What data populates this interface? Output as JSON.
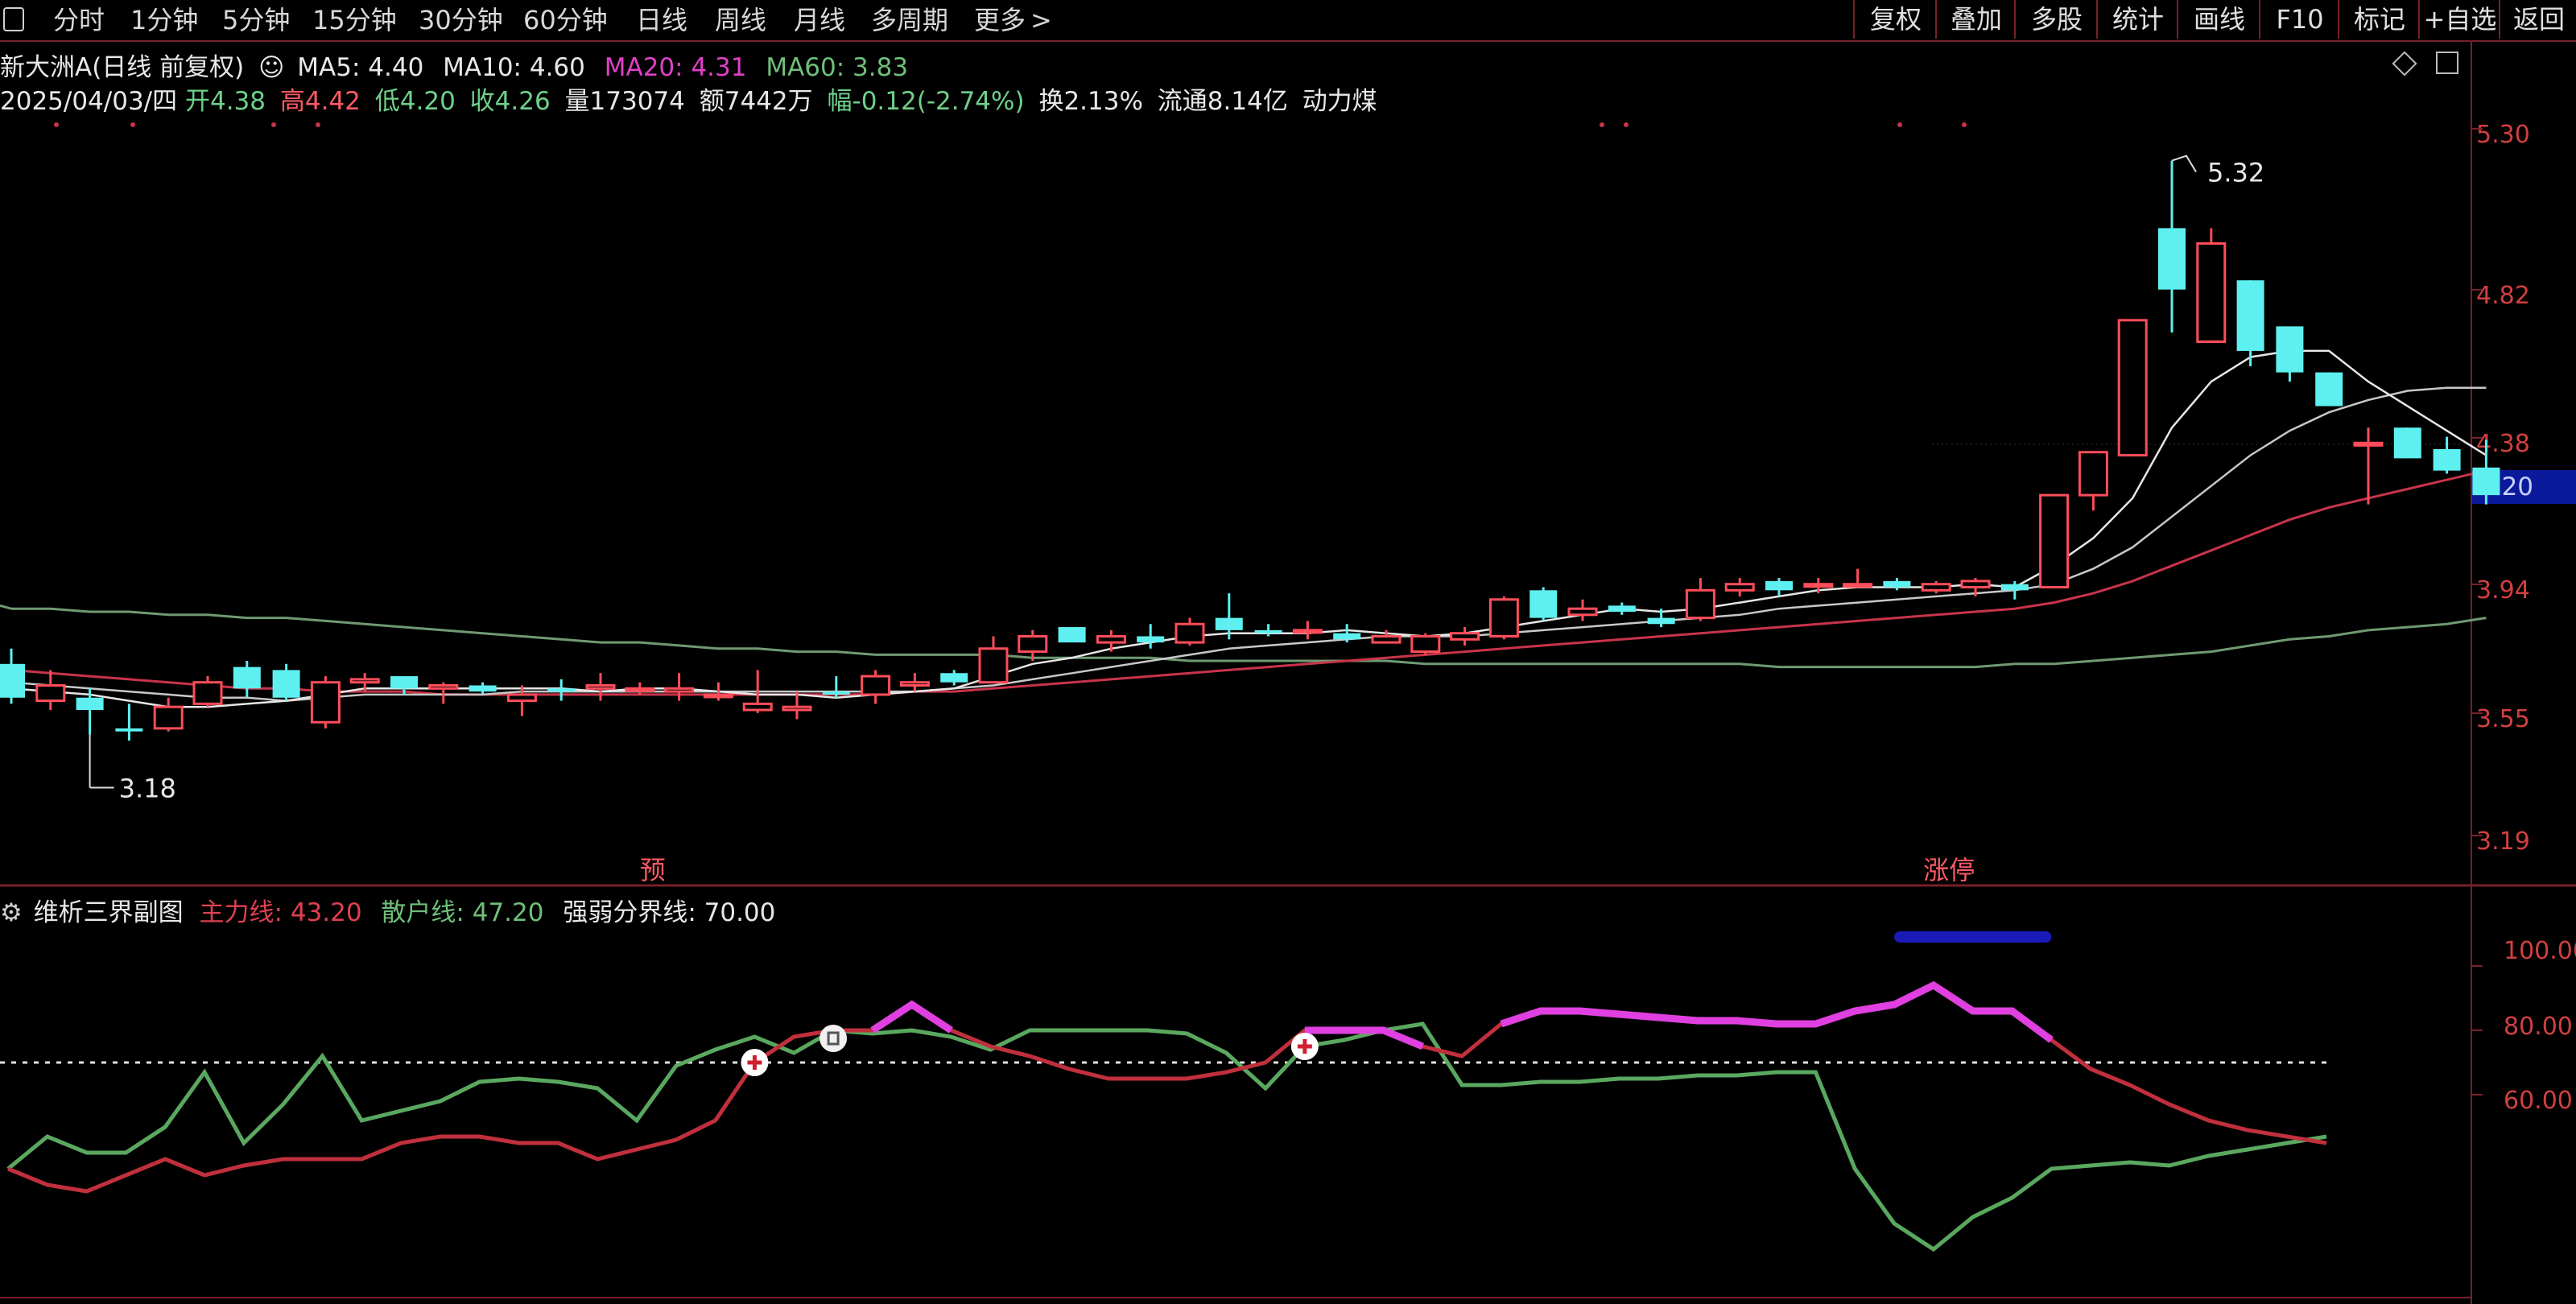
{
  "toolbar": {
    "periods": [
      "分时",
      "1分钟",
      "5分钟",
      "15分钟",
      "30分钟",
      "60分钟",
      "日线",
      "周线",
      "月线",
      "多周期",
      "更多"
    ],
    "more_arrow": ">",
    "right_buttons": [
      "复权",
      "叠加",
      "多股",
      "统计",
      "画线",
      "F10",
      "标记",
      "+自选",
      "返回"
    ]
  },
  "stock": {
    "name": "新大洲A(日线 前复权)",
    "ma5_label": "MA5: 4.40",
    "ma10_label": "MA10: 4.60",
    "ma20_label": "MA20: 4.31",
    "ma60_label": "MA60: 3.83",
    "date": "2025/04/03/四",
    "open": "开4.38",
    "high": "高4.42",
    "low": "低4.20",
    "close": "收4.26",
    "volume": "量173074",
    "amount": "额7442万",
    "change": "幅-0.12(-2.74%)",
    "turnover": "换2.13%",
    "float": "流通8.14亿",
    "concept": "动力煤"
  },
  "price_axis": [
    "5.30",
    "4.82",
    "4.38",
    "3.94",
    "3.55",
    "3.19"
  ],
  "current_price": "4.20",
  "annotations": {
    "high": "5.32",
    "low": "3.18",
    "event1": "预",
    "event2": "涨停"
  },
  "indicator": {
    "name": "维析三界副图",
    "main_label": "主力线: 43.20",
    "retail_label": "散户线: 47.20",
    "threshold_label": "强弱分界线: 70.00",
    "axis": [
      "100.00",
      "80.00",
      "60.00"
    ]
  },
  "colors": {
    "up": "#ff4d5a",
    "down": "#5ef0f0",
    "ma5": "#e6e6e6",
    "ma10": "#c8c8c8",
    "ma20": "#c8344a",
    "ma60": "#6f9a72",
    "main_line": "#c0303c",
    "retail_line": "#5aa860",
    "strong": "#e040e0",
    "marker": "#1a1ab8"
  },
  "chart_data": {
    "type": "candlestick",
    "ylim": [
      3.05,
      5.45
    ],
    "candles": [
      [
        3.68,
        3.73,
        3.55,
        3.57
      ],
      [
        3.56,
        3.66,
        3.53,
        3.61
      ],
      [
        3.57,
        3.6,
        3.45,
        3.53
      ],
      [
        3.47,
        3.55,
        3.43,
        3.46
      ],
      [
        3.47,
        3.57,
        3.46,
        3.54
      ],
      [
        3.55,
        3.64,
        3.54,
        3.62
      ],
      [
        3.67,
        3.69,
        3.57,
        3.6
      ],
      [
        3.66,
        3.68,
        3.56,
        3.57
      ],
      [
        3.49,
        3.64,
        3.47,
        3.62
      ],
      [
        3.62,
        3.65,
        3.59,
        3.63
      ],
      [
        3.64,
        3.64,
        3.58,
        3.6
      ],
      [
        3.6,
        3.62,
        3.55,
        3.61
      ],
      [
        3.61,
        3.62,
        3.58,
        3.59
      ],
      [
        3.56,
        3.61,
        3.51,
        3.58
      ],
      [
        3.6,
        3.63,
        3.56,
        3.59
      ],
      [
        3.6,
        3.65,
        3.56,
        3.61
      ],
      [
        3.6,
        3.62,
        3.58,
        3.6
      ],
      [
        3.59,
        3.65,
        3.56,
        3.6
      ],
      [
        3.58,
        3.62,
        3.56,
        3.58
      ],
      [
        3.53,
        3.66,
        3.52,
        3.55
      ],
      [
        3.53,
        3.59,
        3.5,
        3.54
      ],
      [
        3.59,
        3.64,
        3.57,
        3.58
      ],
      [
        3.58,
        3.66,
        3.55,
        3.64
      ],
      [
        3.61,
        3.65,
        3.59,
        3.62
      ],
      [
        3.65,
        3.66,
        3.61,
        3.62
      ],
      [
        3.62,
        3.77,
        3.62,
        3.73
      ],
      [
        3.72,
        3.79,
        3.69,
        3.77
      ],
      [
        3.8,
        3.8,
        3.75,
        3.75
      ],
      [
        3.75,
        3.79,
        3.72,
        3.77
      ],
      [
        3.77,
        3.81,
        3.73,
        3.75
      ],
      [
        3.75,
        3.83,
        3.74,
        3.81
      ],
      [
        3.83,
        3.91,
        3.76,
        3.79
      ],
      [
        3.79,
        3.81,
        3.77,
        3.78
      ],
      [
        3.79,
        3.82,
        3.76,
        3.79
      ],
      [
        3.78,
        3.81,
        3.75,
        3.76
      ],
      [
        3.75,
        3.79,
        3.75,
        3.77
      ],
      [
        3.72,
        3.78,
        3.71,
        3.77
      ],
      [
        3.76,
        3.8,
        3.74,
        3.78
      ],
      [
        3.77,
        3.9,
        3.76,
        3.89
      ],
      [
        3.92,
        3.93,
        3.82,
        3.83
      ],
      [
        3.84,
        3.89,
        3.82,
        3.86
      ],
      [
        3.87,
        3.88,
        3.84,
        3.85
      ],
      [
        3.83,
        3.86,
        3.8,
        3.81
      ],
      [
        3.83,
        3.96,
        3.82,
        3.92
      ],
      [
        3.92,
        3.96,
        3.9,
        3.94
      ],
      [
        3.95,
        3.96,
        3.9,
        3.92
      ],
      [
        3.94,
        3.96,
        3.91,
        3.94
      ],
      [
        3.94,
        3.99,
        3.93,
        3.94
      ],
      [
        3.95,
        3.96,
        3.92,
        3.93
      ],
      [
        3.92,
        3.95,
        3.91,
        3.94
      ],
      [
        3.93,
        3.96,
        3.9,
        3.95
      ],
      [
        3.94,
        3.95,
        3.89,
        3.92
      ],
      [
        3.93,
        4.23,
        3.93,
        4.23
      ],
      [
        4.23,
        4.37,
        4.18,
        4.37
      ],
      [
        4.36,
        4.8,
        4.36,
        4.8
      ],
      [
        5.1,
        5.32,
        4.76,
        4.9
      ],
      [
        4.73,
        5.1,
        4.73,
        5.05
      ],
      [
        4.93,
        4.93,
        4.65,
        4.7
      ],
      [
        4.78,
        4.78,
        4.6,
        4.63
      ],
      [
        4.63,
        4.63,
        4.52,
        4.52
      ],
      [
        4.4,
        4.45,
        4.2,
        4.4
      ],
      [
        4.45,
        4.45,
        4.35,
        4.35
      ],
      [
        4.38,
        4.42,
        4.3,
        4.31
      ],
      [
        4.32,
        4.41,
        4.2,
        4.23
      ]
    ],
    "ma5": [
      3.6,
      3.59,
      3.58,
      3.56,
      3.54,
      3.54,
      3.55,
      3.56,
      3.58,
      3.6,
      3.6,
      3.6,
      3.6,
      3.6,
      3.6,
      3.59,
      3.6,
      3.6,
      3.59,
      3.58,
      3.58,
      3.57,
      3.58,
      3.59,
      3.6,
      3.64,
      3.68,
      3.7,
      3.73,
      3.75,
      3.77,
      3.78,
      3.78,
      3.78,
      3.79,
      3.78,
      3.77,
      3.78,
      3.8,
      3.82,
      3.84,
      3.86,
      3.85,
      3.86,
      3.88,
      3.9,
      3.92,
      3.93,
      3.93,
      3.93,
      3.94,
      3.93,
      4.0,
      4.09,
      4.22,
      4.45,
      4.6,
      4.68,
      4.7,
      4.7,
      4.6,
      4.52,
      4.44,
      4.36
    ],
    "ma10": [
      3.62,
      3.61,
      3.6,
      3.59,
      3.58,
      3.57,
      3.57,
      3.56,
      3.57,
      3.58,
      3.58,
      3.58,
      3.58,
      3.59,
      3.59,
      3.59,
      3.59,
      3.59,
      3.59,
      3.59,
      3.59,
      3.59,
      3.59,
      3.59,
      3.6,
      3.61,
      3.63,
      3.65,
      3.67,
      3.69,
      3.71,
      3.73,
      3.74,
      3.75,
      3.76,
      3.77,
      3.77,
      3.77,
      3.78,
      3.79,
      3.8,
      3.81,
      3.82,
      3.83,
      3.84,
      3.86,
      3.87,
      3.88,
      3.89,
      3.9,
      3.91,
      3.92,
      3.94,
      3.99,
      4.06,
      4.16,
      4.26,
      4.36,
      4.44,
      4.5,
      4.54,
      4.57,
      4.58,
      4.58
    ],
    "ma20": [
      3.66,
      3.65,
      3.64,
      3.63,
      3.62,
      3.61,
      3.6,
      3.6,
      3.59,
      3.59,
      3.59,
      3.58,
      3.58,
      3.58,
      3.58,
      3.58,
      3.58,
      3.58,
      3.58,
      3.58,
      3.58,
      3.58,
      3.58,
      3.59,
      3.59,
      3.6,
      3.61,
      3.62,
      3.63,
      3.64,
      3.65,
      3.66,
      3.67,
      3.68,
      3.69,
      3.7,
      3.71,
      3.72,
      3.73,
      3.74,
      3.75,
      3.76,
      3.77,
      3.78,
      3.79,
      3.8,
      3.81,
      3.82,
      3.83,
      3.84,
      3.85,
      3.86,
      3.88,
      3.91,
      3.95,
      4.0,
      4.05,
      4.1,
      4.15,
      4.19,
      4.22,
      4.25,
      4.28,
      4.31
    ],
    "ma60": [
      3.86,
      3.86,
      3.85,
      3.85,
      3.84,
      3.84,
      3.83,
      3.83,
      3.82,
      3.81,
      3.8,
      3.79,
      3.78,
      3.77,
      3.76,
      3.75,
      3.75,
      3.74,
      3.73,
      3.73,
      3.72,
      3.72,
      3.71,
      3.71,
      3.71,
      3.71,
      3.7,
      3.7,
      3.7,
      3.7,
      3.69,
      3.69,
      3.69,
      3.69,
      3.69,
      3.69,
      3.68,
      3.68,
      3.68,
      3.68,
      3.68,
      3.68,
      3.68,
      3.68,
      3.68,
      3.67,
      3.67,
      3.67,
      3.67,
      3.67,
      3.67,
      3.68,
      3.68,
      3.69,
      3.7,
      3.71,
      3.72,
      3.74,
      3.76,
      3.77,
      3.79,
      3.8,
      3.81,
      3.83
    ],
    "indicator": {
      "ylim": [
        0,
        110
      ],
      "threshold": 70,
      "main_line": [
        37,
        32,
        30,
        35,
        40,
        35,
        38,
        40,
        40,
        40,
        45,
        47,
        47,
        45,
        45,
        40,
        43,
        46,
        52,
        70,
        78,
        80,
        80,
        88,
        80,
        75,
        72,
        68,
        65,
        65,
        65,
        67,
        70,
        80,
        80,
        80,
        75,
        72,
        82,
        86,
        86,
        85,
        84,
        83,
        83,
        82,
        82,
        86,
        88,
        94,
        86,
        86,
        77,
        68,
        63,
        57,
        52,
        49,
        47,
        45
      ],
      "retail_line": [
        37,
        47,
        42,
        42,
        50,
        67,
        45,
        57,
        72,
        52,
        55,
        58,
        64,
        65,
        64,
        62,
        52,
        69,
        74,
        78,
        73,
        80,
        79,
        80,
        78,
        74,
        80,
        80,
        80,
        80,
        79,
        73,
        62,
        75,
        77,
        80,
        82,
        63,
        63,
        64,
        64,
        65,
        65,
        66,
        66,
        67,
        67,
        37,
        20,
        12,
        22,
        28,
        37,
        38,
        39,
        38,
        41,
        43,
        45,
        47
      ],
      "strong_ranges": [
        [
          22,
          24
        ],
        [
          33,
          36
        ],
        [
          38,
          52
        ]
      ],
      "buy_points": [
        19,
        33
      ],
      "white_point": 21,
      "marker_range": [
        48,
        52
      ]
    }
  }
}
